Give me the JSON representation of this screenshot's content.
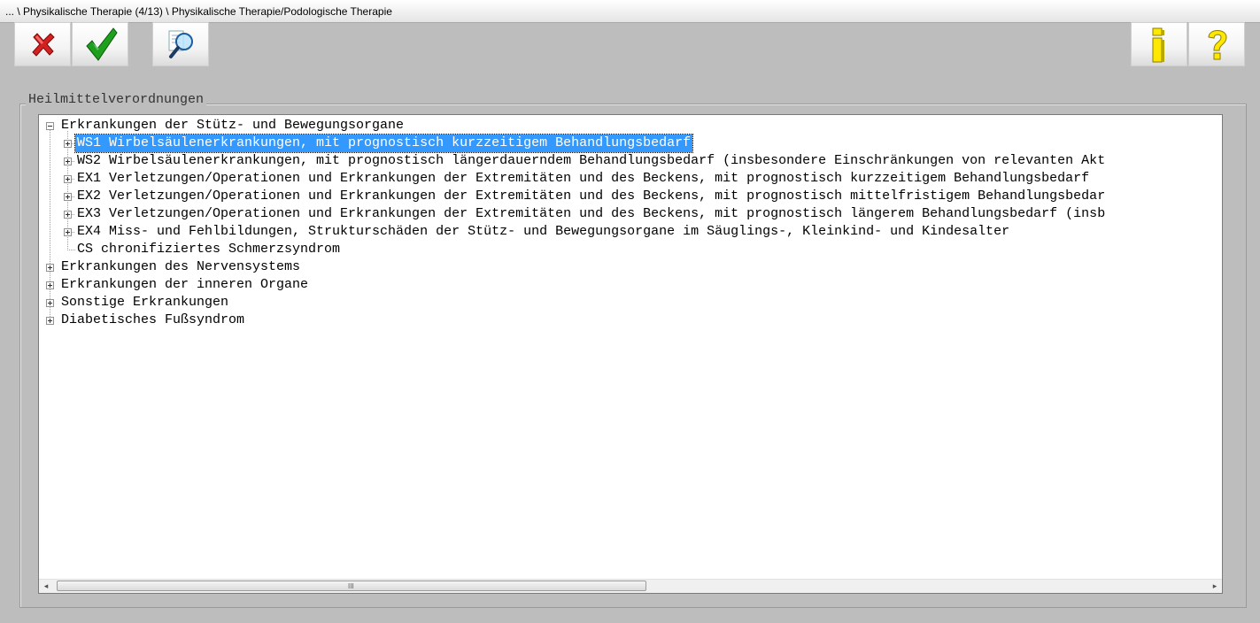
{
  "window": {
    "title": "... \\ Physikalische Therapie (4/13) \\ Physikalische Therapie/Podologische Therapie"
  },
  "toolbar": {
    "buttons": [
      {
        "name": "cancel",
        "icon": "red-x-icon"
      },
      {
        "name": "ok",
        "icon": "green-check-icon"
      },
      {
        "name": "search",
        "icon": "magnifier-icon"
      },
      {
        "name": "info",
        "icon": "info-icon"
      },
      {
        "name": "help",
        "icon": "question-icon"
      }
    ]
  },
  "group": {
    "label": "Heilmittelverordnungen"
  },
  "tree": {
    "nodes": [
      {
        "label": "Erkrankungen der Stütz- und Bewegungsorgane",
        "expanded": true,
        "level": 0
      },
      {
        "label": "WS1 Wirbelsäulenerkrankungen, mit prognostisch kurzzeitigem Behandlungsbedarf",
        "level": 1,
        "selected": true,
        "expanded": false
      },
      {
        "label": "WS2 Wirbelsäulenerkrankungen, mit prognostisch längerdauerndem Behandlungsbedarf (insbesondere Einschränkungen von relevanten Akt",
        "level": 1,
        "expanded": false
      },
      {
        "label": "EX1 Verletzungen/Operationen und Erkrankungen der Extremitäten und des Beckens, mit prognostisch kurzzeitigem Behandlungsbedarf",
        "level": 1,
        "expanded": false
      },
      {
        "label": "EX2 Verletzungen/Operationen und Erkrankungen der Extremitäten und des Beckens, mit prognostisch mittelfristigem Behandlungsbedar",
        "level": 1,
        "expanded": false
      },
      {
        "label": "EX3 Verletzungen/Operationen und Erkrankungen der Extremitäten und des Beckens, mit prognostisch längerem Behandlungsbedarf (insb",
        "level": 1,
        "expanded": false
      },
      {
        "label": "EX4 Miss- und Fehlbildungen, Strukturschäden der Stütz- und Bewegungsorgane im Säuglings-, Kleinkind- und Kindesalter",
        "level": 1,
        "expanded": false
      },
      {
        "label": "CS chronifiziertes Schmerzsyndrom",
        "level": 1,
        "expanded": false
      },
      {
        "label": "Erkrankungen des Nervensystems",
        "level": 0,
        "expanded": false
      },
      {
        "label": "Erkrankungen der inneren Organe",
        "level": 0,
        "expanded": false
      },
      {
        "label": "Sonstige Erkrankungen",
        "level": 0,
        "expanded": false
      },
      {
        "label": "Diabetisches Fußsyndrom",
        "level": 0,
        "expanded": false
      }
    ]
  },
  "scrollbar": {
    "left_arrow": "◂",
    "right_arrow": "▸",
    "grip": "III"
  }
}
